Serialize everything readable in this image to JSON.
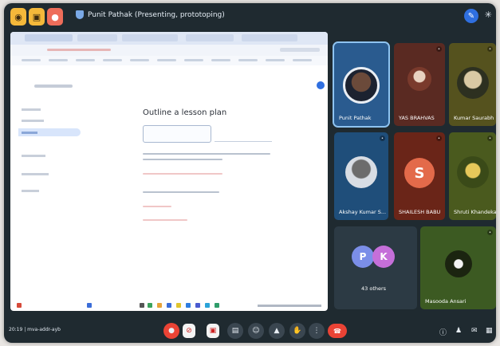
{
  "top_bar": {
    "presenter_title": "Punit Pathak (Presenting, prototoping)",
    "buttons": [
      "mic",
      "camera",
      "record"
    ],
    "edit_icon": "pencil-icon",
    "pin_icon": "pin-icon"
  },
  "shared_screen": {
    "url": "",
    "page_title": "Outline a lesson plan"
  },
  "participants": [
    {
      "name": "Punit Pathak",
      "type": "photo"
    },
    {
      "name": "YAS BRAHVAS",
      "type": "photo"
    },
    {
      "name": "Kumar Saurabh",
      "type": "photo"
    },
    {
      "name": "Akshay Kumar S...",
      "type": "photo"
    },
    {
      "name": "SHAILESH BABU",
      "type": "avatar",
      "initial": "S",
      "color": "#e36a4a"
    },
    {
      "name": "Shruti Khandekar",
      "type": "photo"
    },
    {
      "name": "43 others",
      "type": "group",
      "initials": [
        "P",
        "K"
      ],
      "colors": [
        "#7b8ee8",
        "#c56fd9"
      ]
    },
    {
      "name": "Masooda Ansari",
      "type": "photo"
    }
  ],
  "bottom_bar": {
    "meeting_time": "20:19 | mva-addr-ayb",
    "controls": [
      "mic-icon",
      "camera-icon",
      "captions-icon",
      "emoji-icon",
      "present-icon",
      "hand-icon",
      "more-icon"
    ],
    "hangup_icon": "hangup-icon",
    "right_controls": [
      "info-icon",
      "people-icon",
      "chat-icon",
      "activities-icon"
    ]
  },
  "colors": {
    "background": "#1f2a30",
    "accent_blue": "#2f6fe0",
    "hangup_red": "#ea4335"
  }
}
